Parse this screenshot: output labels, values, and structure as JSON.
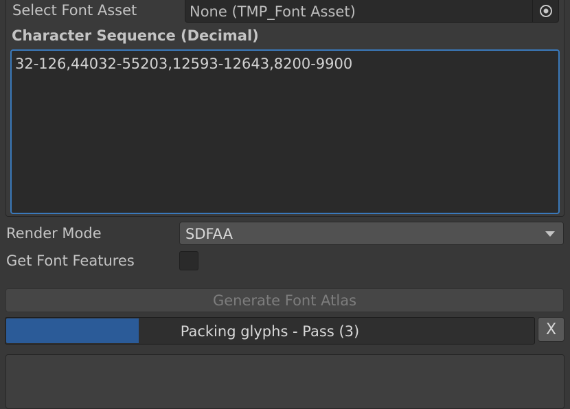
{
  "font_asset": {
    "label": "Select Font Asset",
    "value": "None (TMP_Font Asset)",
    "picker_icon": "object-picker-icon"
  },
  "character_sequence": {
    "label": "Character Sequence (Decimal)",
    "value": "32-126,44032-55203,12593-12643,8200-9900"
  },
  "render_mode": {
    "label": "Render Mode",
    "value": "SDFAA",
    "icon": "dropdown-arrow-icon"
  },
  "font_features": {
    "label": "Get Font Features",
    "checked": false
  },
  "generate_button": {
    "label": "Generate Font Atlas",
    "enabled": false
  },
  "progress": {
    "text": "Packing glyphs - Pass (3)",
    "fraction": 0.25
  },
  "cancel_button": {
    "label": "X"
  },
  "colors": {
    "progress_fill": "#2b5b98",
    "focus_border": "#3a79bb",
    "background": "#383838"
  }
}
